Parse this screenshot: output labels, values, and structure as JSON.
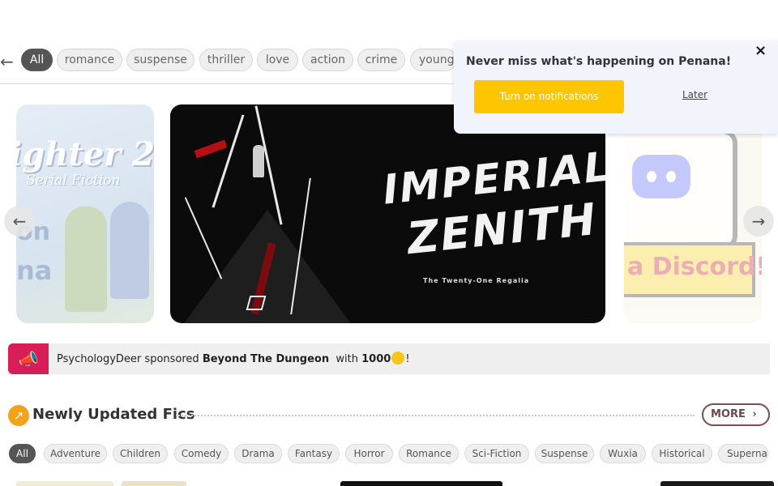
{
  "tags": {
    "back_icon": "arrow-left-icon",
    "items": [
      "All",
      "romance",
      "suspense",
      "thriller",
      "love",
      "action",
      "crime",
      "youngadult"
    ]
  },
  "carousel": {
    "left_slide": {
      "line1": "ighter 2",
      "line2": "Serial Fiction",
      "line3": "on",
      "line4": "na"
    },
    "main_slide": {
      "title_line1": "IMPERIAL",
      "title_line2": "ZENITH",
      "subtitle": "The Twenty-One Regalia"
    },
    "right_slide": {
      "banner_text": "a Discord!"
    },
    "prev_icon": "arrow-left-icon",
    "next_icon": "arrow-right-icon"
  },
  "notification": {
    "title": "Never miss what's happening on Penana!",
    "close_label": "×",
    "turn_on_label": "Turn on notifications",
    "later_label": "Later"
  },
  "sponsor": {
    "icon": "megaphone-icon",
    "user": "PsychologyDeer",
    "verb": "sponsored",
    "story": "Beyond The Dungeon",
    "with_text": "with",
    "amount": "1000",
    "suffix": "!",
    "coin_icon": "coin-icon"
  },
  "newly_updated": {
    "icon": "trending-icon",
    "title": "Newly Updated Fics",
    "more_label": "MORE",
    "more_icon": "chevron-right-icon",
    "genres": [
      "All",
      "Adventure",
      "Children",
      "Comedy",
      "Drama",
      "Fantasy",
      "Horror",
      "Romance",
      "Sci-Fiction",
      "Suspense",
      "Wuxia",
      "Historical",
      "Supernatural"
    ]
  },
  "colors": {
    "accent_yellow": "#ffc600",
    "sponsor_pink": "#d81d59",
    "active_tag": "#555555"
  }
}
